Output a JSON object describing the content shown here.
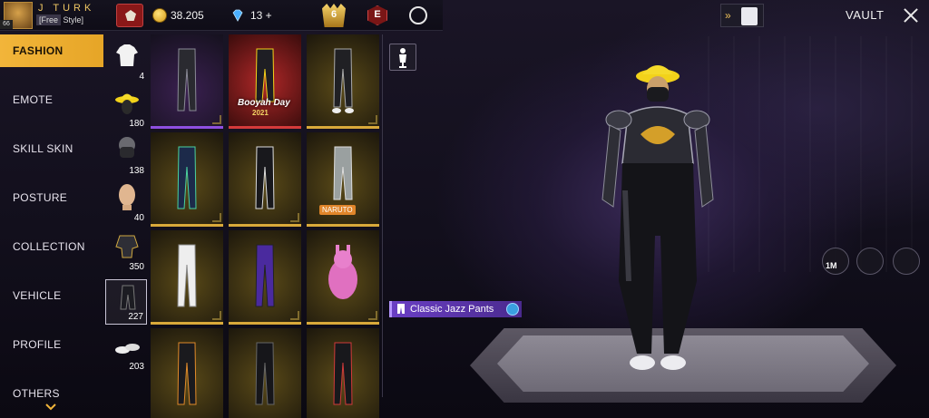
{
  "player": {
    "name": "J TURK",
    "level": "66",
    "tag_left": "[Free",
    "tag_right": "Style]"
  },
  "currency": {
    "coins": "38.205",
    "diamonds": "13 +"
  },
  "badges": {
    "rank_number": "6",
    "elite_letter": "E"
  },
  "sidebar": {
    "items": [
      {
        "label": "FASHION",
        "active": true
      },
      {
        "label": "EMOTE",
        "active": false
      },
      {
        "label": "SKILL SKIN",
        "active": false
      },
      {
        "label": "POSTURE",
        "active": false
      },
      {
        "label": "COLLECTION",
        "active": false
      },
      {
        "label": "VEHICLE",
        "active": false
      },
      {
        "label": "PROFILE",
        "active": false
      },
      {
        "label": "OTHERS",
        "active": false
      }
    ]
  },
  "categories": [
    {
      "icon": "top-icon",
      "count": "4"
    },
    {
      "icon": "hat-icon",
      "count": "180"
    },
    {
      "icon": "mask-icon",
      "count": "138"
    },
    {
      "icon": "face-icon",
      "count": "40"
    },
    {
      "icon": "outfit-icon",
      "count": "350"
    },
    {
      "icon": "pants-icon",
      "count": "227",
      "active": true
    },
    {
      "icon": "shoes-icon",
      "count": "203"
    }
  ],
  "grid_items": [
    {
      "name": "dark-pants",
      "rarity": "purple"
    },
    {
      "name": "booyah-pants",
      "rarity": "red",
      "tag": "Booyah Day",
      "tag_sub": "2021"
    },
    {
      "name": "black-jogger",
      "rarity": "gold"
    },
    {
      "name": "navy-pants",
      "rarity": "gold"
    },
    {
      "name": "black-stripe-pants",
      "rarity": "gold"
    },
    {
      "name": "naruto-pants",
      "rarity": "gold",
      "tag2": "NARUTO"
    },
    {
      "name": "white-pants",
      "rarity": "gold"
    },
    {
      "name": "purple-pants",
      "rarity": "gold"
    },
    {
      "name": "pink-bunny",
      "rarity": "gold"
    },
    {
      "name": "orange-black-pants",
      "rarity": "gold"
    },
    {
      "name": "black-cargo",
      "rarity": "gold"
    },
    {
      "name": "red-black-pants",
      "rarity": "gold"
    }
  ],
  "selected_item": {
    "name": "Classic Jazz Pants"
  },
  "vault": {
    "label": "VAULT",
    "arrows": "»"
  },
  "actions": {
    "count_label": "1M"
  },
  "colors": {
    "accent": "#f2b53a",
    "label_bg": "#6a3fc4",
    "rarity_purple": "#8e4fe0",
    "rarity_gold": "#d9a93a",
    "rarity_red": "#d43a3a"
  }
}
